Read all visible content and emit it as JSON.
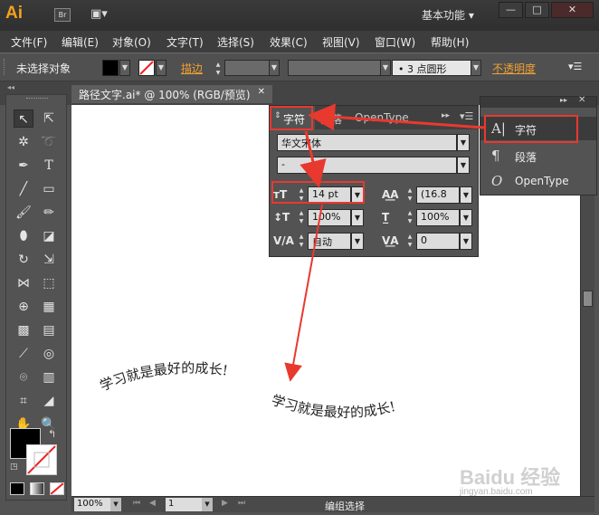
{
  "app": {
    "logo": "Ai",
    "bridge": "Br",
    "workspace": "基本功能"
  },
  "window_controls": {
    "minimize": "—",
    "maximize": "□",
    "close": "✕"
  },
  "menu": [
    "文件(F)",
    "编辑(E)",
    "对象(O)",
    "文字(T)",
    "选择(S)",
    "效果(C)",
    "视图(V)",
    "窗口(W)",
    "帮助(H)"
  ],
  "control_bar": {
    "status": "未选择对象",
    "stroke_label": "描边",
    "brush_label": "3 点圆形",
    "opacity_label": "不透明度",
    "fill_color": "#000000",
    "stroke_color": "#ffffff"
  },
  "document_tab": {
    "title": "路径文字.ai* @ 100% (RGB/预览)",
    "close": "✕"
  },
  "char_panel": {
    "tabs": [
      "字符",
      "段落",
      "OpenType"
    ],
    "font_family": "华文宋体",
    "font_style": "-",
    "font_size": "14 pt",
    "leading": "(16.8",
    "vertical_scale": "100%",
    "horizontal_scale": "100%",
    "kerning": "自动",
    "tracking": "0"
  },
  "side_panel": {
    "items": [
      {
        "label": "字符",
        "icon": "character-icon"
      },
      {
        "label": "段落",
        "icon": "paragraph-icon"
      },
      {
        "label": "OpenType",
        "icon": "opentype-icon"
      }
    ]
  },
  "canvas": {
    "text1": "学习就是最好的成长!",
    "text2": "学习就是最好的成长!"
  },
  "status": {
    "zoom": "100%",
    "page": "1",
    "mode": "编组选择"
  },
  "watermark": {
    "text": "Baidu 经验",
    "url": "jingyan.baidu.com"
  }
}
